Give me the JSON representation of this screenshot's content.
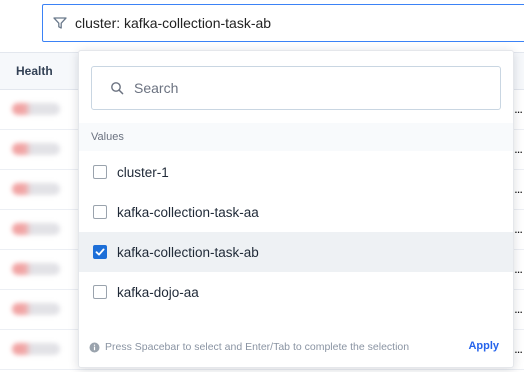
{
  "filter": {
    "icon": "filter-icon",
    "text": "cluster: kafka-collection-task-ab"
  },
  "table": {
    "columns": [
      "Health"
    ],
    "row_trailing_text": "..."
  },
  "dropdown": {
    "search": {
      "icon": "search-icon",
      "placeholder": "Search"
    },
    "section_label": "Values",
    "options": [
      {
        "label": "cluster-1",
        "checked": false
      },
      {
        "label": "kafka-collection-task-aa",
        "checked": false
      },
      {
        "label": "kafka-collection-task-ab",
        "checked": true
      },
      {
        "label": "kafka-dojo-aa",
        "checked": false
      }
    ],
    "footer": {
      "icon": "info-icon",
      "hint": "Press Spacebar to select and Enter/Tab to complete the selection",
      "apply_label": "Apply"
    }
  },
  "colors": {
    "accent": "#1d6fd8",
    "link": "#2563eb",
    "focus_border": "#3b82f6"
  }
}
